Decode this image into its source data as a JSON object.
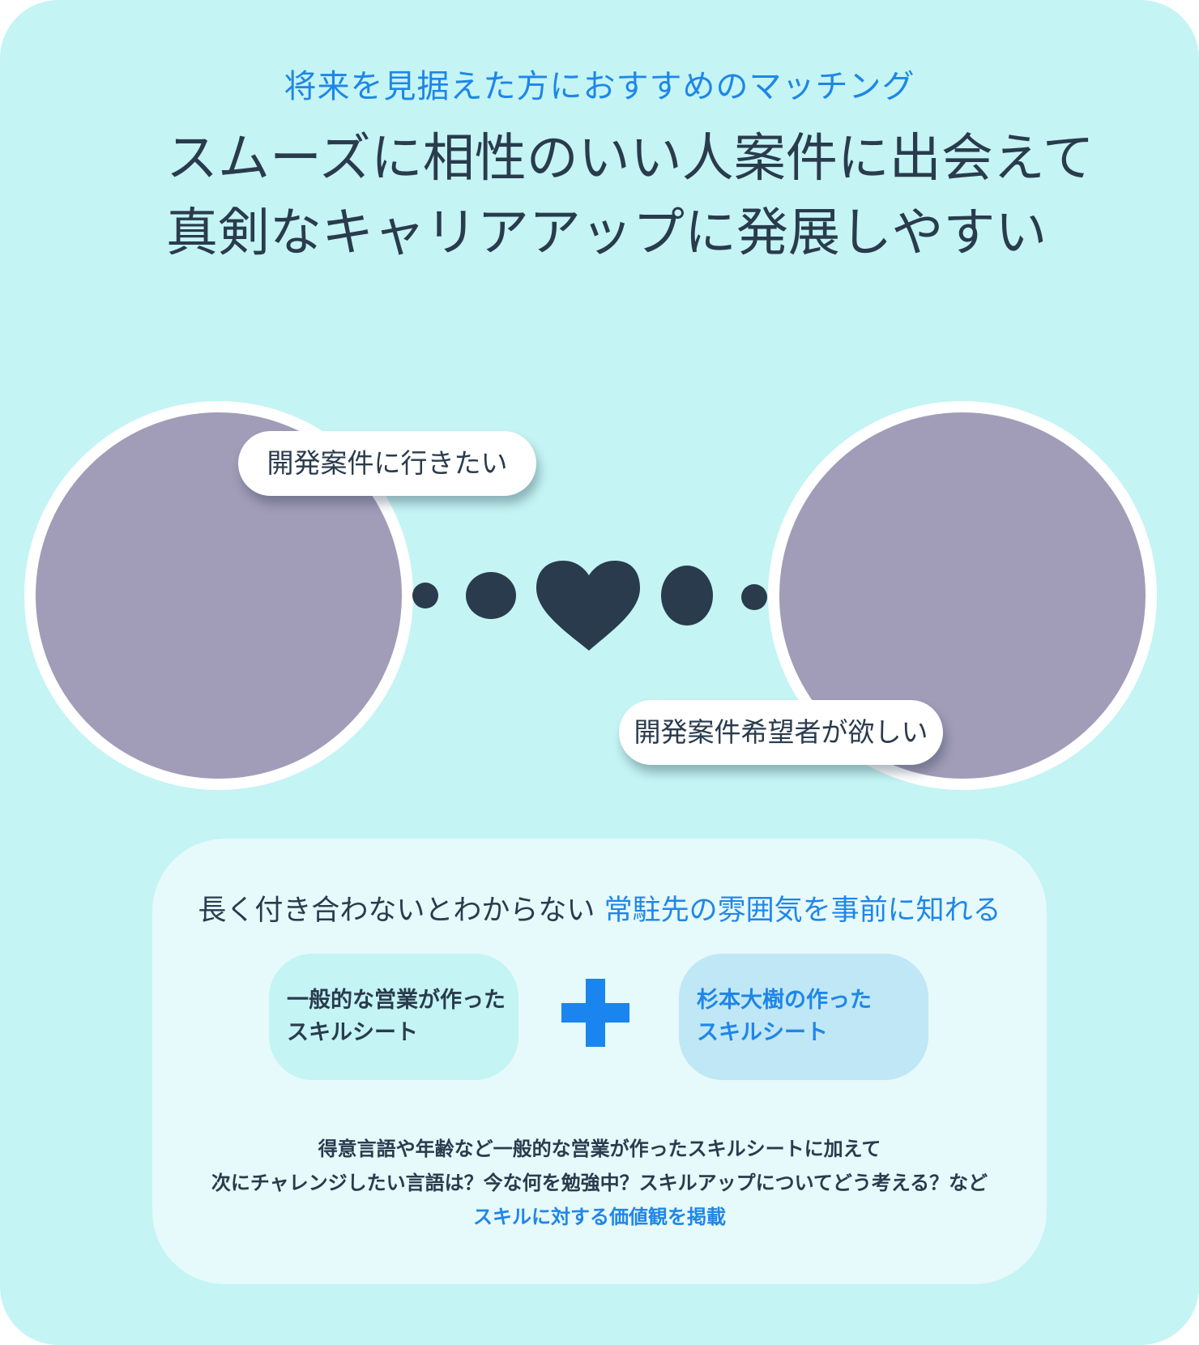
{
  "header": {
    "eyebrow": "将来を見据えた方におすすめのマッチング",
    "headline_line1": "スムーズに相性のいい人案件に出会えて",
    "headline_line2": "真剣なキャリアアップに発展しやすい"
  },
  "matching": {
    "left_bubble": "開発案件に行きたい",
    "right_bubble": "開発案件希望者が欲しい",
    "connector_icon": "heart-icon"
  },
  "panel": {
    "lead_plain": "長く付き合わないとわからない ",
    "lead_highlight": "常駐先の雰囲気を事前に知れる",
    "general_sheet_line1": "一般的な営業が作った",
    "general_sheet_line2": "スキルシート",
    "plus_icon": "plus-icon",
    "sugimoto_sheet_line1": "杉本大樹の作った",
    "sugimoto_sheet_line2": "スキルシート",
    "desc_line1": "得意言語や年齢など一般的な営業が作ったスキルシートに加えて",
    "desc_line2": "次にチャレンジしたい言語は？今な何を勉強中？スキルアップについてどう考える？など",
    "desc_highlight": "スキルに対する価値観を掲載"
  },
  "colors": {
    "background": "#c4f4f4",
    "accent_blue": "#1f86e8",
    "text_dark": "#2a3b4d",
    "avatar": "#a19cb8"
  }
}
